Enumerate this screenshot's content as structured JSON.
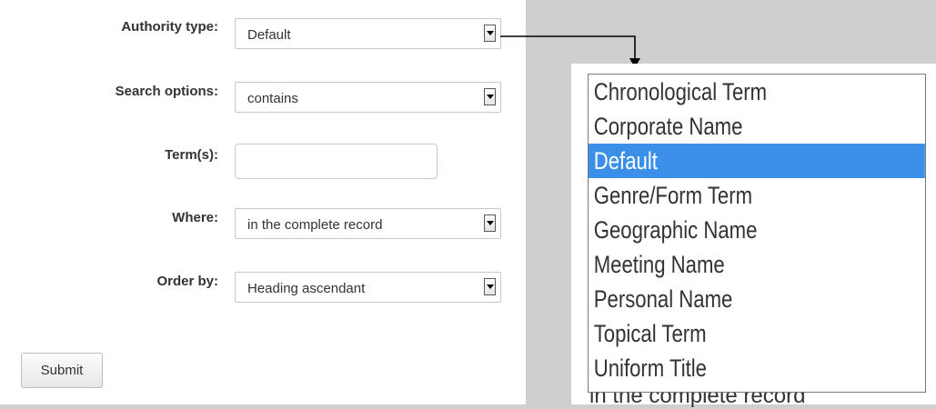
{
  "form": {
    "authority_type": {
      "label": "Authority type:",
      "value": "Default"
    },
    "search_options": {
      "label": "Search options:",
      "value": "contains"
    },
    "terms": {
      "label": "Term(s):",
      "value": ""
    },
    "where": {
      "label": "Where:",
      "value": "in the complete record"
    },
    "order_by": {
      "label": "Order by:",
      "value": "Heading ascendant"
    },
    "submit_label": "Submit"
  },
  "dropdown": {
    "options": [
      "Chronological Term",
      "Corporate Name",
      "Default",
      "Genre/Form Term",
      "Geographic Name",
      "Meeting Name",
      "Personal Name",
      "Topical Term",
      "Uniform Title"
    ],
    "selected": "Default",
    "underlying_text": "in the complete record"
  },
  "colors": {
    "selection": "#3b8fe8",
    "label_text": "#333333",
    "background": "#cfcfcf"
  }
}
